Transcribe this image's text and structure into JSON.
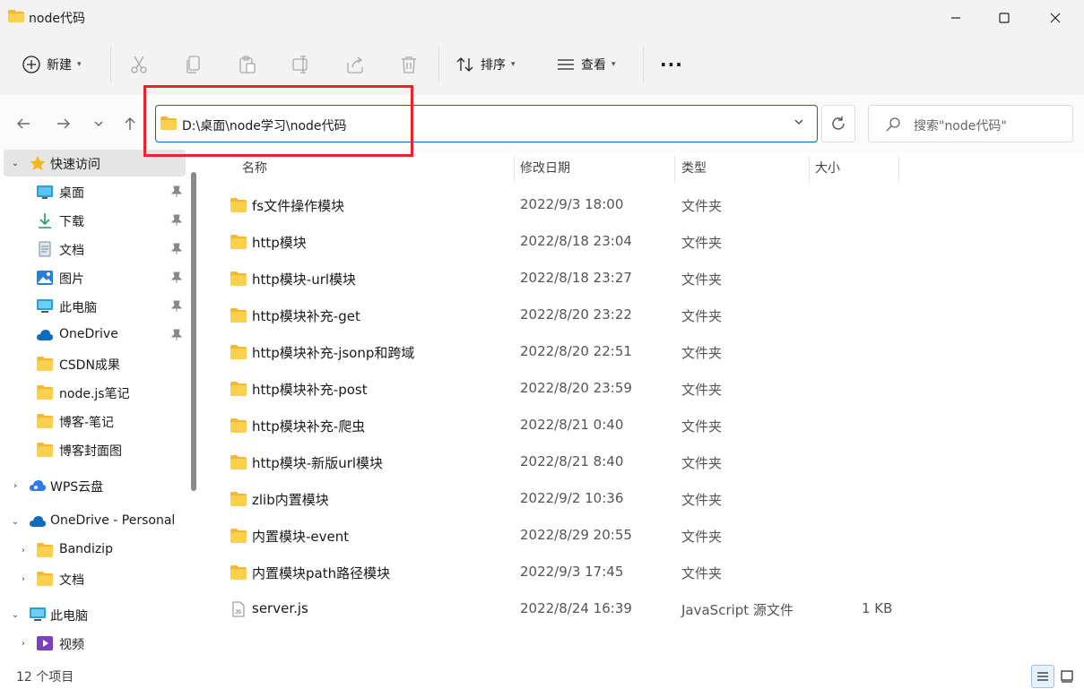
{
  "window": {
    "title": "node代码"
  },
  "toolbar": {
    "new_label": "新建",
    "sort_label": "排序",
    "view_label": "查看",
    "more_label": "···"
  },
  "address": {
    "path": "D:\\桌面\\node学习\\node代码"
  },
  "search": {
    "placeholder": "搜索\"node代码\""
  },
  "sidebar": {
    "items": [
      {
        "label": "快速访问",
        "icon": "star-icon",
        "expander": "expanded"
      },
      {
        "label": "桌面",
        "icon": "desktop-icon",
        "pinned": true
      },
      {
        "label": "下载",
        "icon": "download-icon",
        "pinned": true
      },
      {
        "label": "文档",
        "icon": "document-icon",
        "pinned": true
      },
      {
        "label": "图片",
        "icon": "picture-icon",
        "pinned": true
      },
      {
        "label": "此电脑",
        "icon": "computer-icon",
        "pinned": true
      },
      {
        "label": "OneDrive",
        "icon": "cloud-icon",
        "pinned": true
      },
      {
        "label": "CSDN成果",
        "icon": "folder-icon"
      },
      {
        "label": "node.js笔记",
        "icon": "folder-icon"
      },
      {
        "label": "博客-笔记",
        "icon": "folder-icon"
      },
      {
        "label": "博客封面图",
        "icon": "folder-icon"
      },
      {
        "label": "WPS云盘",
        "icon": "wps-cloud-icon",
        "expander": "collapsed"
      },
      {
        "label": "OneDrive - Personal",
        "icon": "cloud-icon",
        "expander": "expanded"
      },
      {
        "label": "Bandizip",
        "icon": "folder-icon",
        "expander": "collapsed"
      },
      {
        "label": "文档",
        "icon": "folder-icon",
        "expander": "collapsed"
      },
      {
        "label": "此电脑",
        "icon": "computer-icon",
        "expander": "expanded"
      },
      {
        "label": "视频",
        "icon": "video-icon",
        "expander": "collapsed"
      }
    ]
  },
  "columns": {
    "name": "名称",
    "date": "修改日期",
    "type": "类型",
    "size": "大小"
  },
  "files": [
    {
      "name": "fs文件操作模块",
      "date": "2022/9/3 18:00",
      "type": "文件夹",
      "size": "",
      "icon": "folder-icon"
    },
    {
      "name": "http模块",
      "date": "2022/8/18 23:04",
      "type": "文件夹",
      "size": "",
      "icon": "folder-icon"
    },
    {
      "name": "http模块-url模块",
      "date": "2022/8/18 23:27",
      "type": "文件夹",
      "size": "",
      "icon": "folder-icon"
    },
    {
      "name": "http模块补充-get",
      "date": "2022/8/20 23:22",
      "type": "文件夹",
      "size": "",
      "icon": "folder-icon"
    },
    {
      "name": "http模块补充-jsonp和跨域",
      "date": "2022/8/20 22:51",
      "type": "文件夹",
      "size": "",
      "icon": "folder-icon"
    },
    {
      "name": "http模块补充-post",
      "date": "2022/8/20 23:59",
      "type": "文件夹",
      "size": "",
      "icon": "folder-icon"
    },
    {
      "name": "http模块补充-爬虫",
      "date": "2022/8/21 0:40",
      "type": "文件夹",
      "size": "",
      "icon": "folder-icon"
    },
    {
      "name": "http模块-新版url模块",
      "date": "2022/8/21 8:40",
      "type": "文件夹",
      "size": "",
      "icon": "folder-icon"
    },
    {
      "name": "zlib内置模块",
      "date": "2022/9/2 10:36",
      "type": "文件夹",
      "size": "",
      "icon": "folder-icon"
    },
    {
      "name": "内置模块-event",
      "date": "2022/8/29 20:55",
      "type": "文件夹",
      "size": "",
      "icon": "folder-icon"
    },
    {
      "name": "内置模块path路径模块",
      "date": "2022/9/3 17:45",
      "type": "文件夹",
      "size": "",
      "icon": "folder-icon"
    },
    {
      "name": "server.js",
      "date": "2022/8/24 16:39",
      "type": "JavaScript 源文件",
      "size": "1 KB",
      "icon": "js-file-icon"
    }
  ],
  "status": {
    "count": "12 个项目"
  },
  "colors": {
    "folder": "#f8c93a",
    "accent": "#0067c0",
    "highlight_box": "#e8232b"
  }
}
